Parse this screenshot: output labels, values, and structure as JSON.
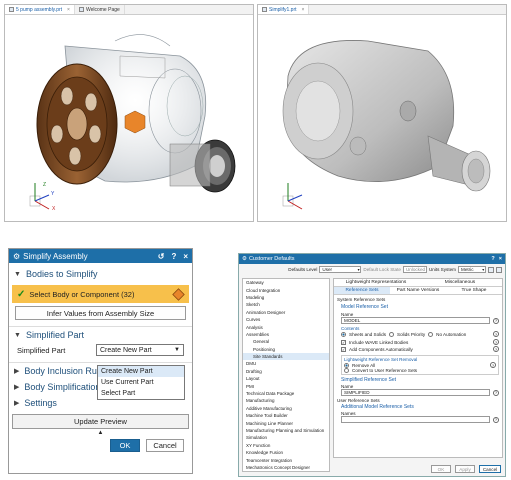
{
  "left_window": {
    "tabs": [
      {
        "label": "5 pump assembly.prt",
        "close": "×"
      },
      {
        "label": "Welcome Page",
        "close": ""
      }
    ]
  },
  "right_window": {
    "tabs": [
      {
        "label": "Simplify1.prt",
        "close": "×"
      }
    ]
  },
  "axes": {
    "x": "X",
    "y": "Y",
    "z": "Z"
  },
  "simplify_dialog": {
    "title": "Simplify Assembly",
    "title_buttons": [
      "↺",
      "?",
      "×"
    ],
    "bodies_to_simplify": "Bodies to Simplify",
    "select_body": "Select Body or Component (32)",
    "infer_button": "Infer Values from Assembly Size",
    "simplified_part_section": "Simplified Part",
    "simplified_part_label": "Simplified Part",
    "dropdown_value": "Create New Part",
    "dropdown_options": [
      "Create New Part",
      "Use Current Part",
      "Select Part"
    ],
    "body_inclusion_section": "Body Inclusion Ru",
    "body_simplification_section": "Body Simplification Rules",
    "settings_section": "Settings",
    "update_preview": "Update Preview",
    "ok": "OK",
    "cancel": "Cancel"
  },
  "customer_defaults": {
    "title": "Customer Defaults",
    "defaults_level_label": "Defaults Level",
    "defaults_level_value": "User",
    "lock_label": "Default Lock State",
    "lock_value": "Unlocked",
    "units_label": "Units System",
    "units_value": "Metric",
    "tree": [
      "Gateway",
      "Cloud Integration",
      "Modeling",
      "Sketch",
      "Animation Designer",
      "Curves",
      "Analysis",
      "Assemblies",
      "General",
      "Positioning",
      "Site Standards",
      "DMU",
      "Drafting",
      "Layout",
      "PMI",
      "Technical Data Package",
      "Manufacturing",
      "Additive Manufacturing",
      "Machine Tool Builder",
      "Machining Line Planner",
      "Manufacturing Planning and Simulation",
      "Simulation",
      "XY Function",
      "Knowledge Fusion",
      "Teamcenter Integration",
      "Mechatronics Concept Designer"
    ],
    "tree_selected": 10,
    "top_tabs": [
      "Lightweight Representations",
      "Miscellaneous"
    ],
    "sub_tabs": [
      "Reference Sets",
      "Part Name Versions",
      "True Shape"
    ],
    "system_ref_sets": "System Reference Sets",
    "model_ref_set": "Model Reference Set",
    "name_label": "Name",
    "model_name_value": "MODEL",
    "contents_label": "Contents",
    "contents_options": [
      "Sheets and Solids",
      "Solids Priority",
      "No Automation"
    ],
    "include_wave": "Include WAVE Linked Bodies",
    "add_components": "Add Components Automatically",
    "lw_removal": "Lightweight Reference Set Removal",
    "removal_options": [
      "Remove All",
      "Convert to User Reference Sets"
    ],
    "simplified_ref_set": "Simplified Reference Set",
    "simplified_name_value": "SIMPLIFIED",
    "user_ref_sets": "User Reference Sets",
    "additional_model_ref_sets": "Additional Model Reference Sets",
    "names_label": "Names",
    "ok": "OK",
    "apply": "Apply",
    "cancel": "Cancel"
  },
  "colors": {
    "accent": "#1e6fa8",
    "selection": "#f7c04b",
    "pump_brown": "#7a4a22"
  }
}
